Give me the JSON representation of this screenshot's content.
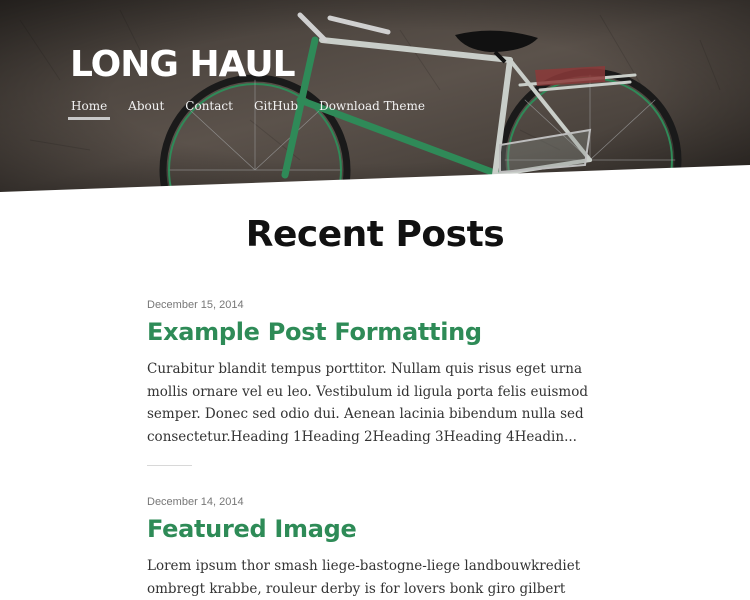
{
  "site": {
    "title": "LONG HAUL"
  },
  "nav": {
    "items": [
      {
        "label": "Home",
        "active": true
      },
      {
        "label": "About",
        "active": false
      },
      {
        "label": "Contact",
        "active": false
      },
      {
        "label": "GitHub",
        "active": false
      },
      {
        "label": "Download Theme",
        "active": false
      }
    ]
  },
  "main": {
    "heading": "Recent Posts",
    "posts": [
      {
        "date": "December 15, 2014",
        "title": "Example Post Formatting",
        "excerpt": "Curabitur blandit tempus porttitor. Nullam quis risus eget urna mollis ornare vel eu leo. Vestibulum id ligula porta felis euismod semper. Donec sed odio dui. Aenean lacinia bibendum nulla sed consectetur.Heading 1Heading 2Heading 3Heading 4Headin..."
      },
      {
        "date": "December 14, 2014",
        "title": "Featured Image",
        "excerpt": "Lorem ipsum thor smash liege-bastogne-liege landbouwkrediet ombregt krabbe, rouleur derby is for lovers bonk giro gilbert bidon. Driedaagse de"
      }
    ]
  },
  "colors": {
    "accent": "#2e8b57",
    "heading": "#111111",
    "text": "#333333",
    "date": "#777777"
  },
  "icons": {
    "hero": "bicycle-photo"
  }
}
